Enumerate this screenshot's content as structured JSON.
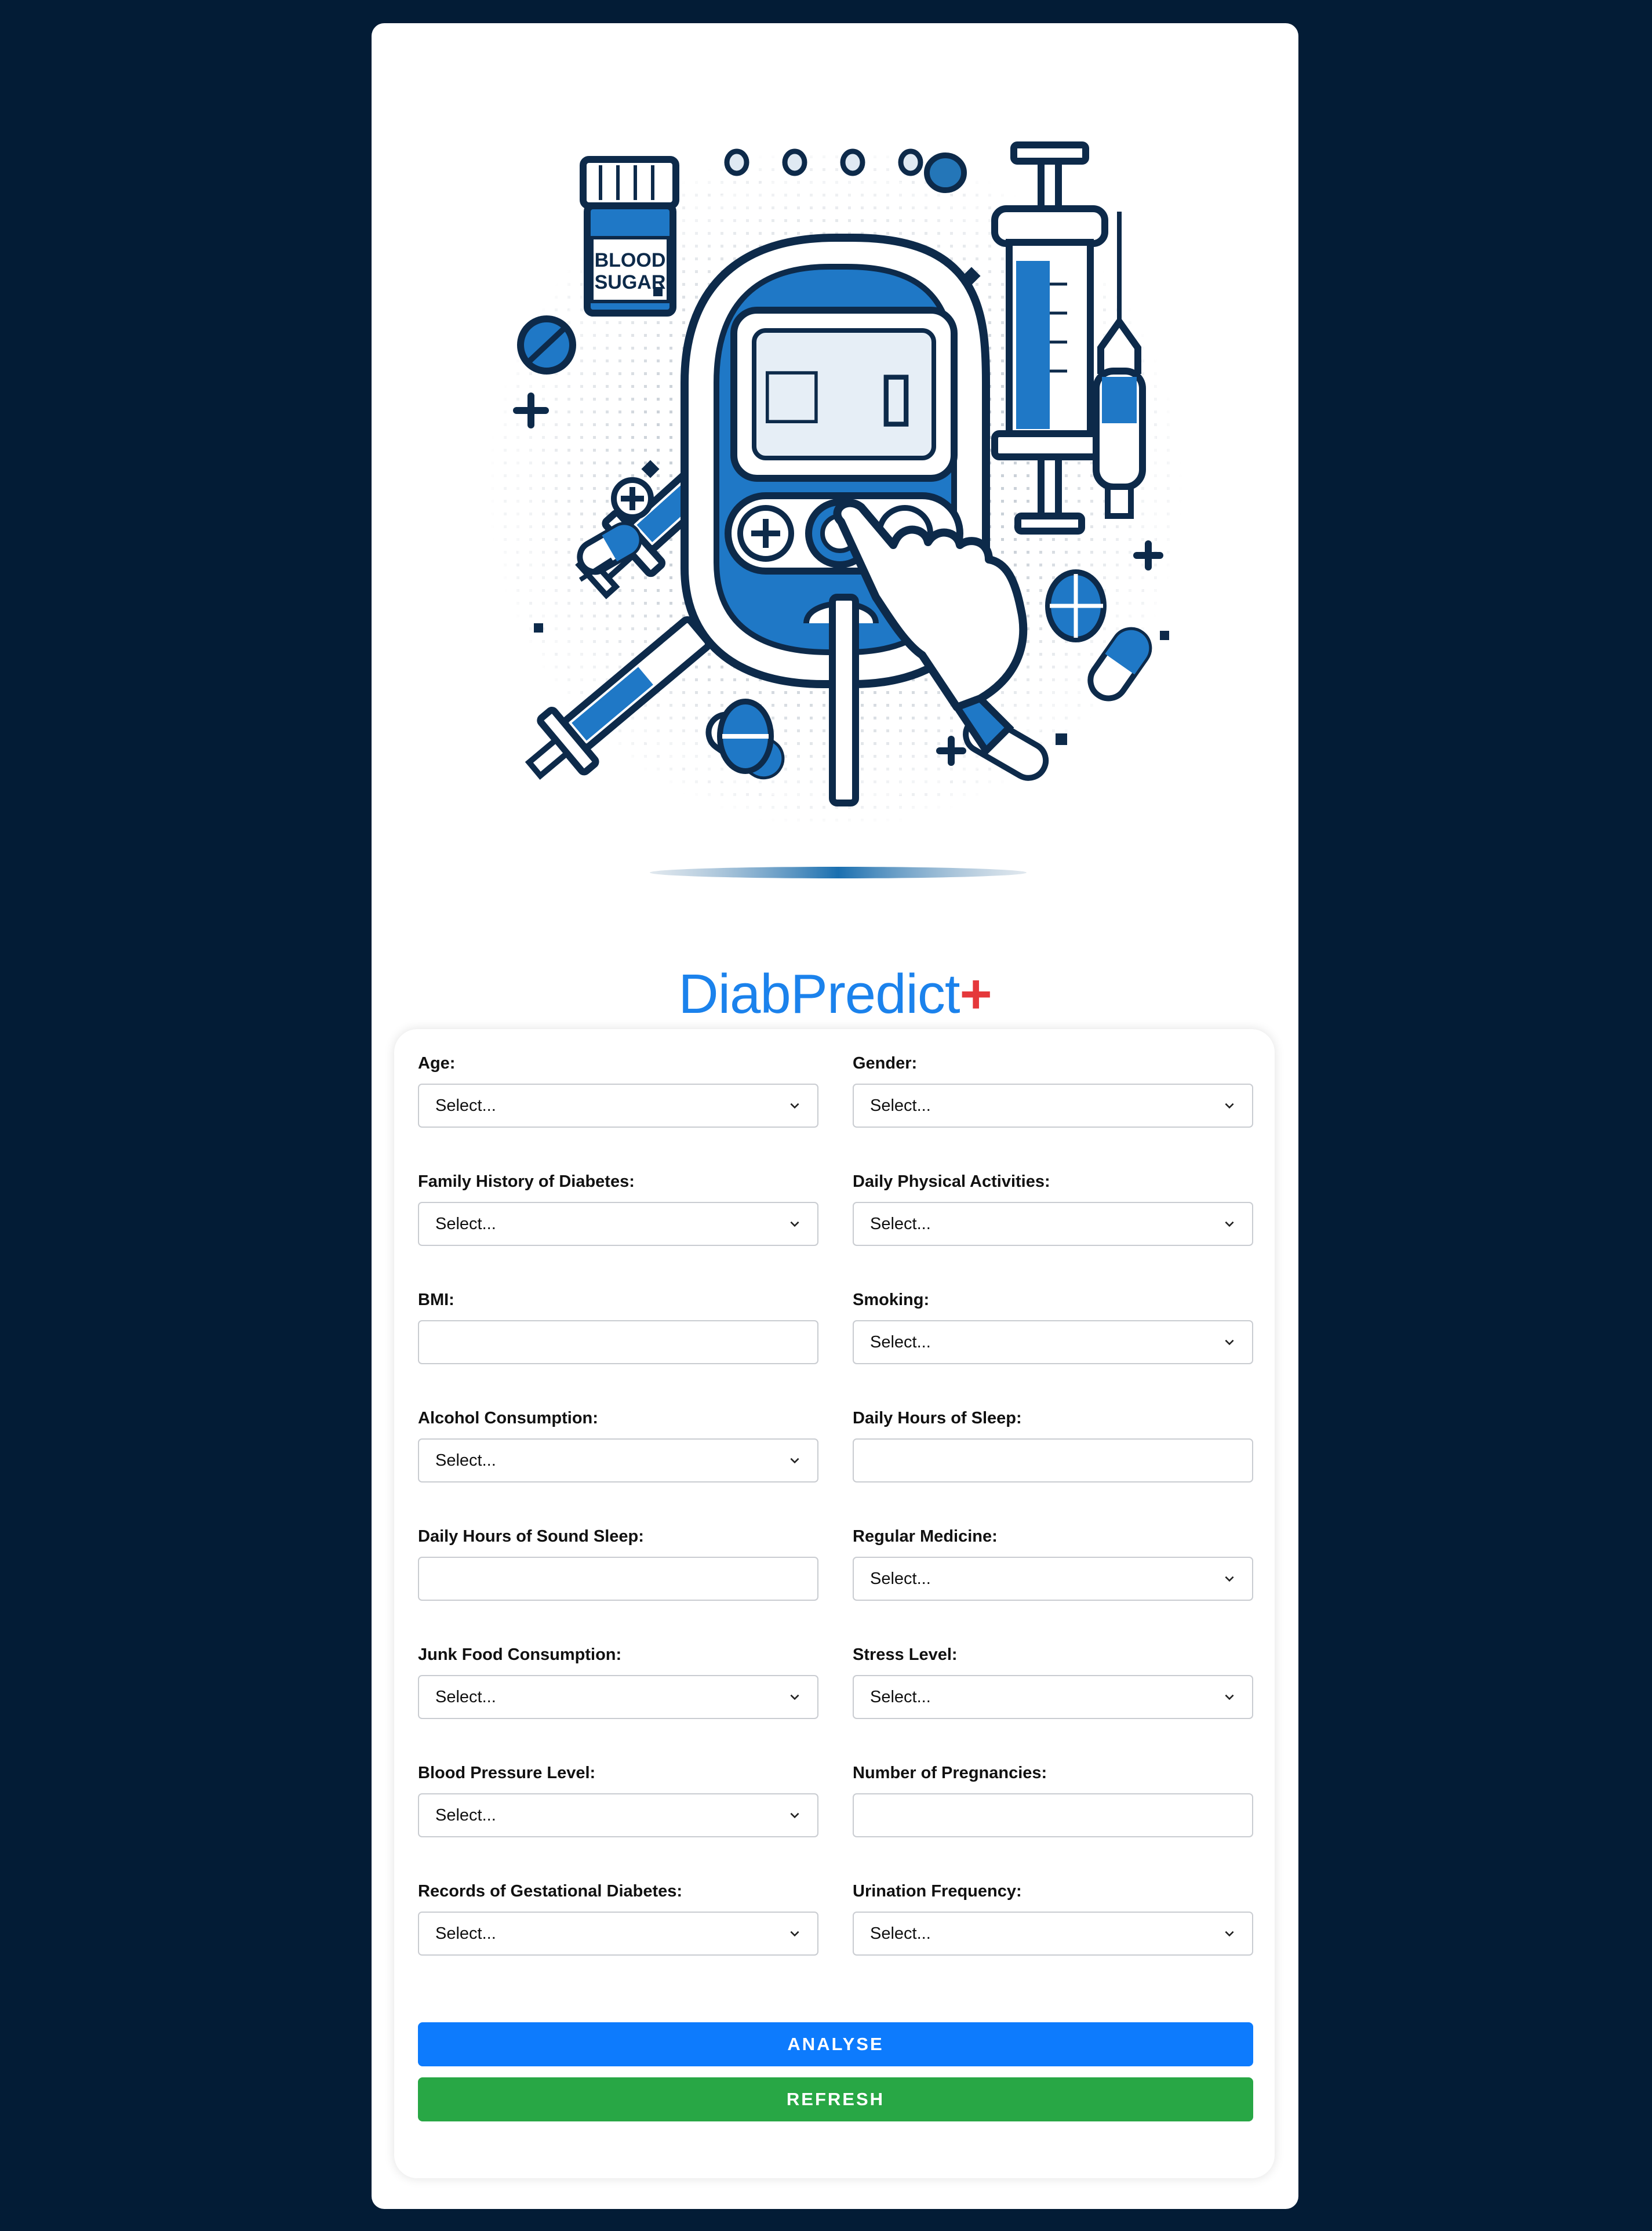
{
  "app": {
    "title_main": "DiabPredict",
    "title_plus": "+"
  },
  "illustration": {
    "jar_label_line1": "BLOOD",
    "jar_label_line2": "SUGAR",
    "meter_display": "□ ▯"
  },
  "form": {
    "fields": [
      {
        "name": "age",
        "label": "Age:",
        "type": "select",
        "value": "Select..."
      },
      {
        "name": "gender",
        "label": "Gender:",
        "type": "select",
        "value": "Select..."
      },
      {
        "name": "family-history",
        "label": "Family History of Diabetes:",
        "type": "select",
        "value": "Select..."
      },
      {
        "name": "physical-activities",
        "label": "Daily Physical Activities:",
        "type": "select",
        "value": "Select..."
      },
      {
        "name": "bmi",
        "label": "BMI:",
        "type": "input",
        "value": ""
      },
      {
        "name": "smoking",
        "label": "Smoking:",
        "type": "select",
        "value": "Select..."
      },
      {
        "name": "alcohol",
        "label": "Alcohol Consumption:",
        "type": "select",
        "value": "Select..."
      },
      {
        "name": "sleep-hours",
        "label": "Daily Hours of Sleep:",
        "type": "input",
        "value": ""
      },
      {
        "name": "sound-sleep",
        "label": "Daily Hours of Sound Sleep:",
        "type": "input",
        "value": ""
      },
      {
        "name": "regular-medicine",
        "label": "Regular Medicine:",
        "type": "select",
        "value": "Select..."
      },
      {
        "name": "junk-food",
        "label": "Junk Food Consumption:",
        "type": "select",
        "value": "Select..."
      },
      {
        "name": "stress-level",
        "label": "Stress Level:",
        "type": "select",
        "value": "Select..."
      },
      {
        "name": "blood-pressure",
        "label": "Blood Pressure Level:",
        "type": "select",
        "value": "Select..."
      },
      {
        "name": "pregnancies",
        "label": "Number of Pregnancies:",
        "type": "input",
        "value": ""
      },
      {
        "name": "gestational-diabetes",
        "label": "Records of Gestational Diabetes:",
        "type": "select",
        "value": "Select..."
      },
      {
        "name": "urination-frequency",
        "label": "Urination Frequency:",
        "type": "select",
        "value": "Select..."
      }
    ],
    "analyse_label": "ANALYSE",
    "refresh_label": "REFRESH"
  },
  "colors": {
    "page_bg": "#031c36",
    "title_blue": "#1b82ec",
    "title_plus_red": "#e5383b",
    "analyse_blue": "#0d7bfd",
    "refresh_green": "#28a745"
  }
}
